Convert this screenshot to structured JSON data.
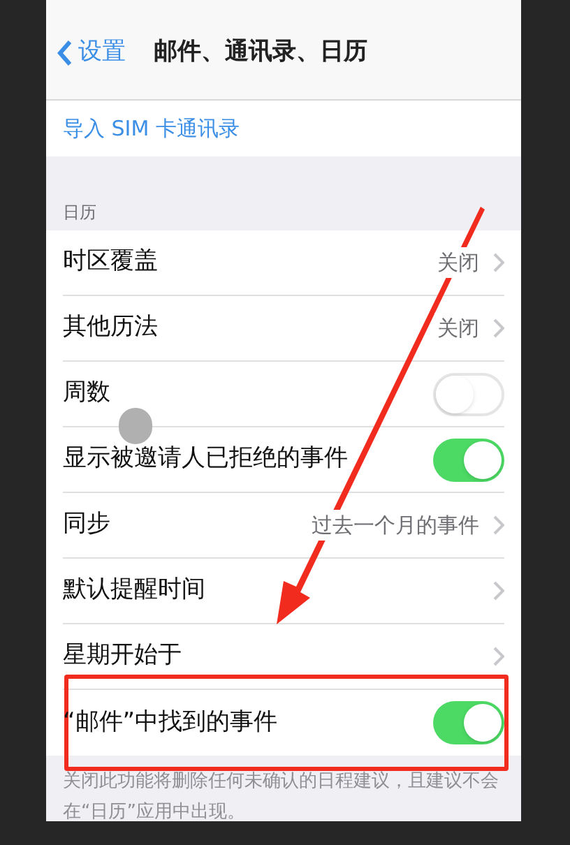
{
  "nav": {
    "back": "设置",
    "title": "邮件、通讯录、日历"
  },
  "import_link": "导入 SIM 卡通讯录",
  "section_header": "日历",
  "rows": [
    {
      "kind": "disclosure",
      "label": "时区覆盖",
      "value": "关闭"
    },
    {
      "kind": "disclosure",
      "label": "其他历法",
      "value": "关闭"
    },
    {
      "kind": "toggle",
      "label": "周数",
      "on": false
    },
    {
      "kind": "toggle",
      "label": "显示被邀请人已拒绝的事件",
      "on": true
    },
    {
      "kind": "disclosure",
      "label": "同步",
      "value": "过去一个月的事件"
    },
    {
      "kind": "disclosure",
      "label": "默认提醒时间"
    },
    {
      "kind": "disclosure",
      "label": "星期开始于"
    },
    {
      "kind": "toggle",
      "label": "“邮件”中找到的事件",
      "on": true
    }
  ],
  "footer": "关闭此功能将删除任何未确认的日程建议，且建议不会在“日历”应用中出现。"
}
